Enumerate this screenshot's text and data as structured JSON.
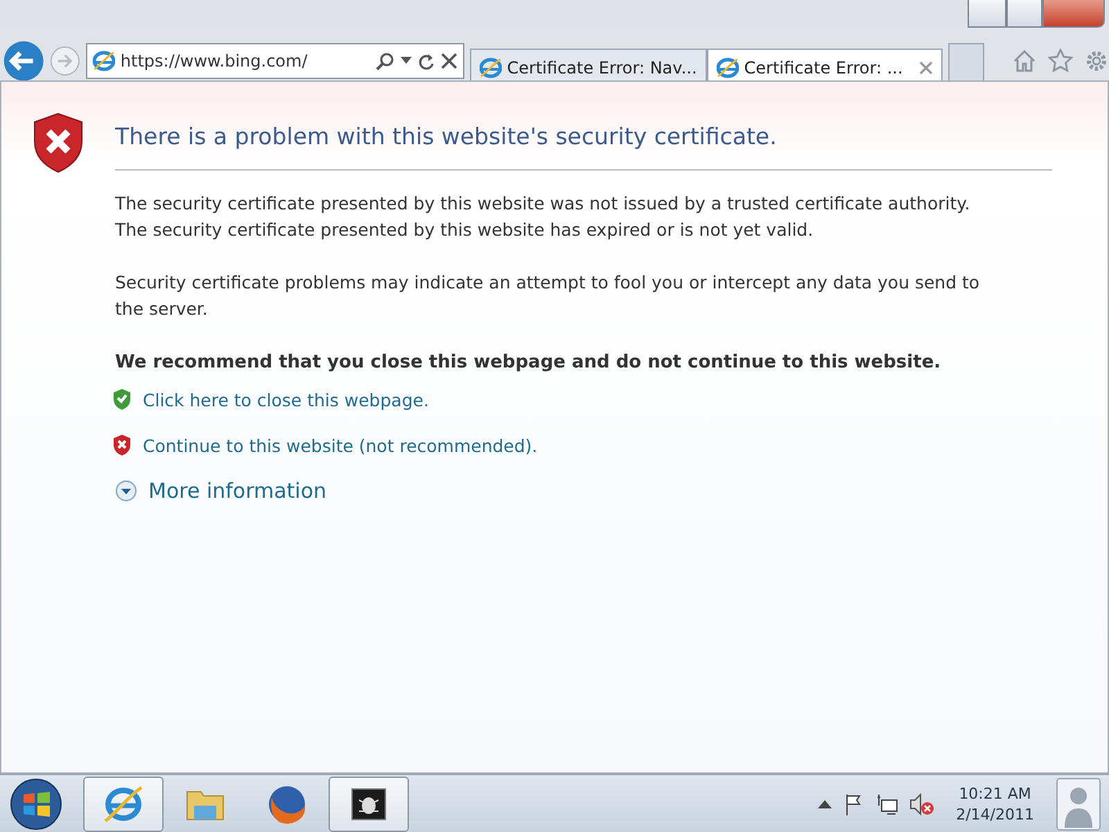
{
  "browser": {
    "address": "https://www.bing.com/",
    "tabs": [
      {
        "label": "Certificate Error: Nav...",
        "selected": false
      },
      {
        "label": "Certificate Error: ...",
        "selected": true
      }
    ]
  },
  "page": {
    "title": "There is a problem with this website's security certificate.",
    "messages": [
      "The security certificate presented by this website was not issued by a trusted certificate authority.",
      "The security certificate presented by this website has expired or is not yet valid."
    ],
    "warning": "Security certificate problems may indicate an attempt to fool you or intercept any data you send to the server.",
    "recommendation": "We recommend that you close this webpage and do not continue to this website.",
    "links": [
      {
        "kind": "safe",
        "text": "Click here to close this webpage."
      },
      {
        "kind": "danger",
        "text": "Continue to this website (not recommended)."
      }
    ],
    "more": "More information"
  },
  "taskbar": {
    "apps": [
      {
        "kind": "ie",
        "selected": true
      },
      {
        "kind": "folder",
        "selected": false
      },
      {
        "kind": "firefox",
        "selected": false
      },
      {
        "kind": "bug",
        "selected": true
      }
    ],
    "time": "10:21 AM",
    "date": "2/14/2011"
  }
}
